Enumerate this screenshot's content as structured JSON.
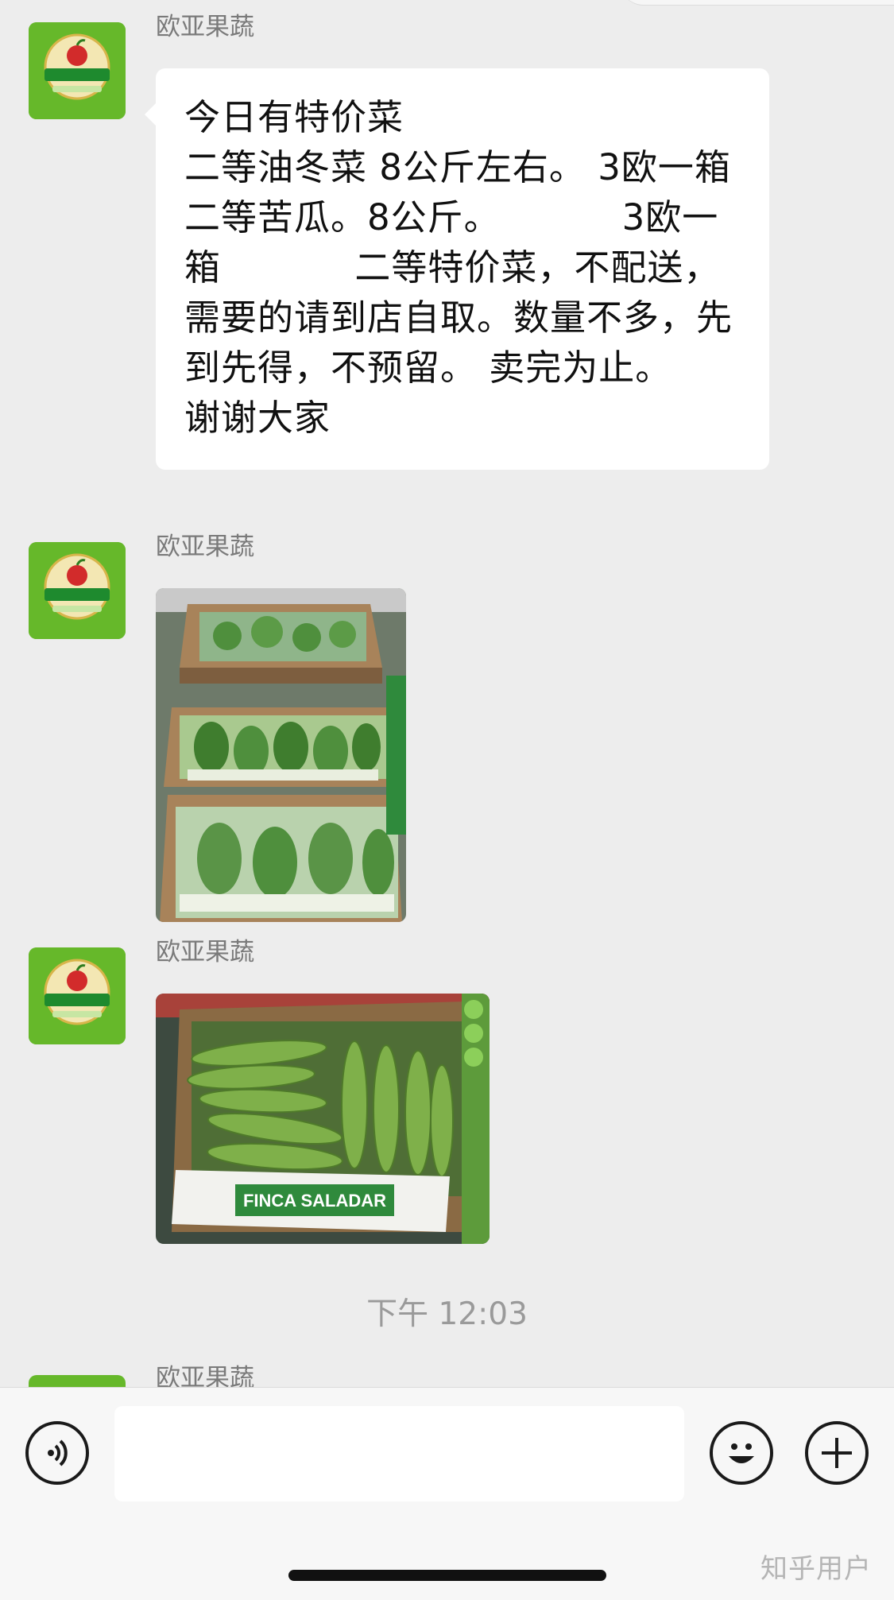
{
  "messages": [
    {
      "sender": "欧亚果蔬",
      "type": "text",
      "text": "今日有特价菜\n二等油冬菜 8公斤左右。 3欧一箱\n二等苦瓜。8公斤。          3欧一箱           二等特价菜，不配送，需要的请到店自取。数量不多，先到先得，不预留。 卖完为止。   谢谢大家"
    },
    {
      "sender": "欧亚果蔬",
      "type": "image",
      "image_icon": "bok-choy-crates-photo"
    },
    {
      "sender": "欧亚果蔬",
      "type": "image",
      "image_icon": "bitter-melon-box-photo",
      "photo_label": "FINCA SALADAR"
    }
  ],
  "timestamp": "下午 12:03",
  "partial_sender": "欧亚果蔬",
  "input": {
    "value": "",
    "voice_icon": "voice-icon",
    "emoji_icon": "emoji-icon",
    "plus_icon": "plus-icon"
  },
  "watermark": "知乎用户",
  "colors": {
    "background": "#ededed",
    "bubble": "#ffffff",
    "avatar_green": "#66b82a"
  }
}
